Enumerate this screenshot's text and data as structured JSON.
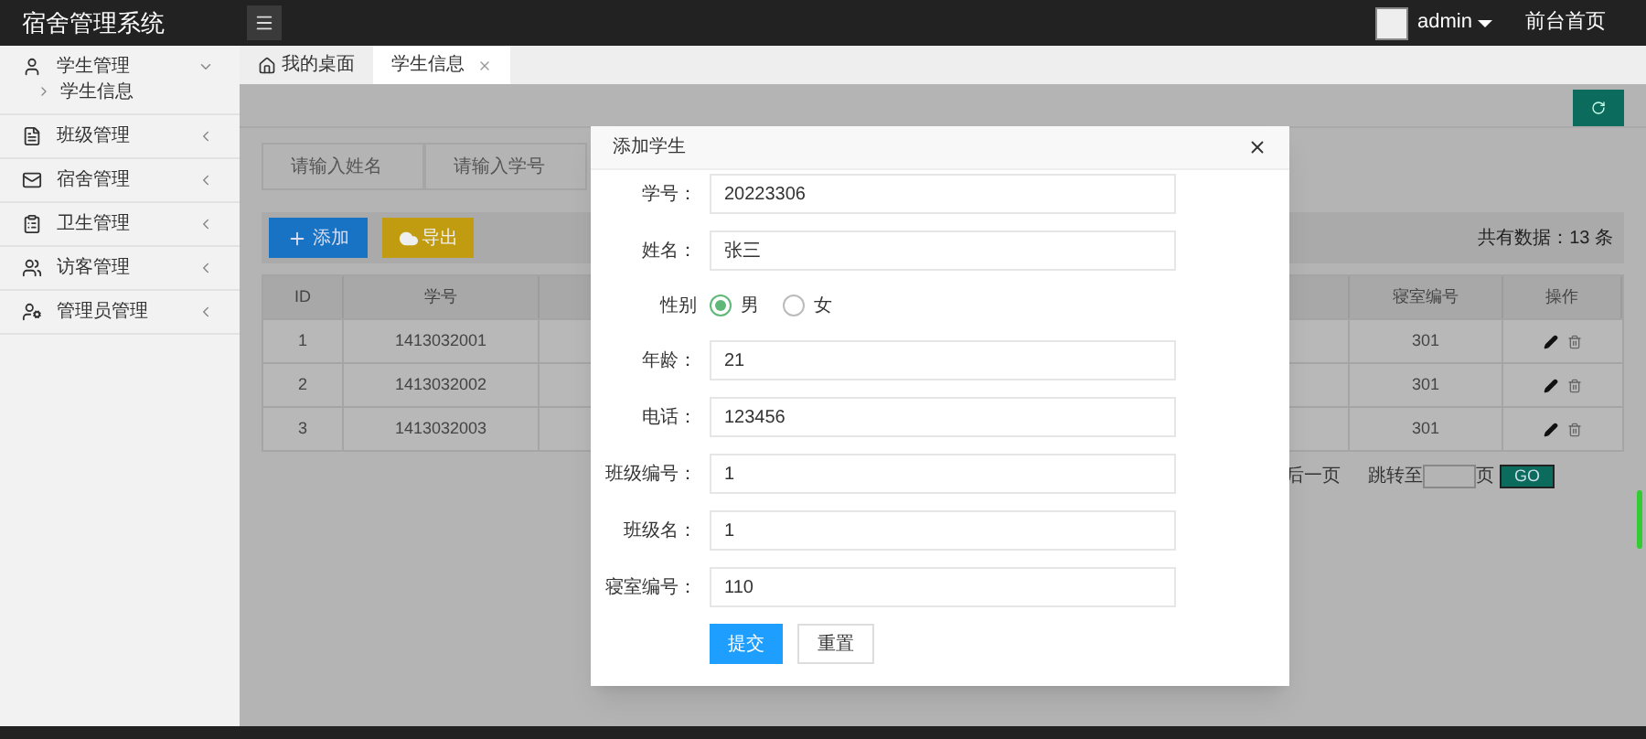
{
  "header": {
    "title": "宿舍管理系统",
    "user": "admin",
    "link": "前台首页"
  },
  "sidebar": {
    "items": [
      {
        "label": "学生管理",
        "expanded": true,
        "children": [
          {
            "label": "学生信息"
          }
        ]
      },
      {
        "label": "班级管理",
        "expanded": false
      },
      {
        "label": "宿舍管理",
        "expanded": false
      },
      {
        "label": "卫生管理",
        "expanded": false
      },
      {
        "label": "访客管理",
        "expanded": false
      },
      {
        "label": "管理员管理",
        "expanded": false
      }
    ]
  },
  "tabs": [
    {
      "label": "我的桌面",
      "selected": false,
      "kind": "home"
    },
    {
      "label": "学生信息",
      "selected": true,
      "kind": "closable"
    }
  ],
  "search": {
    "fields": [
      {
        "placeholder": "请输入姓名"
      },
      {
        "placeholder": "请输入学号"
      }
    ]
  },
  "toolbar": {
    "add": "添加",
    "export": "导出",
    "total": "共有数据：13 条"
  },
  "table": {
    "columns": [
      "ID",
      "学号",
      "寝室编号",
      "操作"
    ],
    "rows": [
      {
        "id": "1",
        "student_no": "1413032001",
        "dorm": "301"
      },
      {
        "id": "2",
        "student_no": "1413032002",
        "dorm": "301"
      },
      {
        "id": "3",
        "student_no": "1413032003",
        "dorm": "301"
      }
    ]
  },
  "pagination": {
    "last": "后一页",
    "jump": "跳转至",
    "page": "页",
    "go": "GO"
  },
  "modal": {
    "title": "添加学生",
    "fields": [
      {
        "kind": "text",
        "label": "学号：",
        "value": "20223306"
      },
      {
        "kind": "text",
        "label": "姓名：",
        "value": "张三"
      },
      {
        "kind": "radio",
        "label": "性别",
        "options": [
          {
            "label": "男",
            "selected": true
          },
          {
            "label": "女",
            "selected": false
          }
        ]
      },
      {
        "kind": "text",
        "label": "年龄：",
        "value": "21"
      },
      {
        "kind": "text",
        "label": "电话：",
        "value": "123456"
      },
      {
        "kind": "text",
        "label": "班级编号：",
        "value": "1"
      },
      {
        "kind": "text",
        "label": "班级名：",
        "value": "1"
      },
      {
        "kind": "text",
        "label": "寝室编号：",
        "value": "110"
      }
    ],
    "submit": "提交",
    "reset": "重置"
  }
}
